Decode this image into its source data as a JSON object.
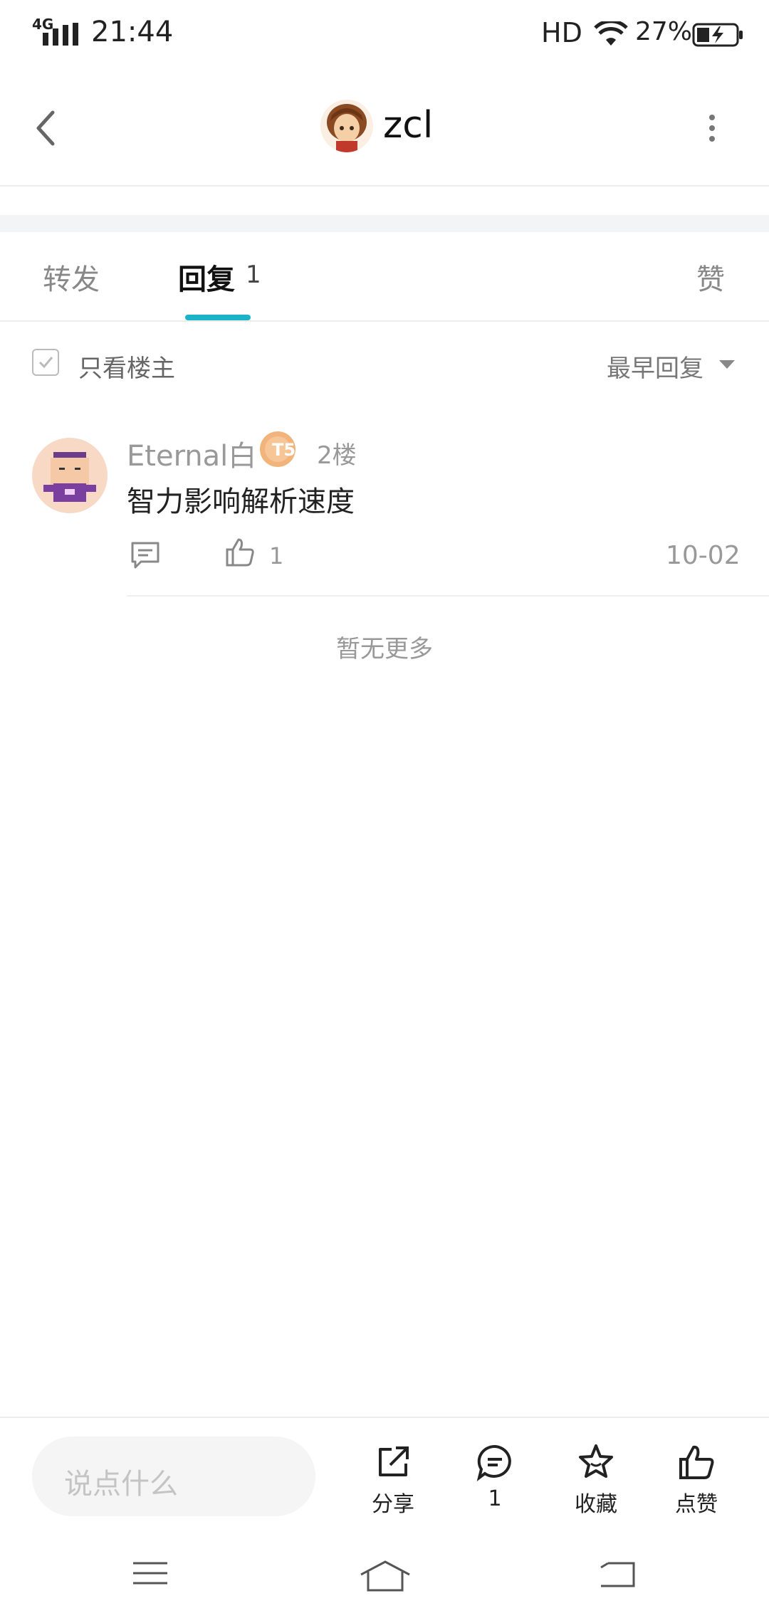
{
  "status_bar": {
    "network": "4G",
    "time": "21:44",
    "hd": "HD",
    "battery": "27%"
  },
  "header": {
    "username": "zcl",
    "back_icon": "chevron-left-icon",
    "more_icon": "more-vertical-icon"
  },
  "tabs": {
    "repost": "转发",
    "reply": "回复",
    "reply_count": "1",
    "like": "赞",
    "accent": "#1bb3c7"
  },
  "filter": {
    "only_op": "只看楼主",
    "sort": "最早回复"
  },
  "comments": [
    {
      "author": "Eternal白",
      "level_badge": "T5",
      "floor": "2楼",
      "text": "智力影响解析速度",
      "likes": "1",
      "date": "10-02"
    }
  ],
  "no_more": "暂无更多",
  "bottom_bar": {
    "placeholder": "说点什么",
    "share": "分享",
    "comments": "1",
    "favorite": "收藏",
    "like": "点赞"
  }
}
